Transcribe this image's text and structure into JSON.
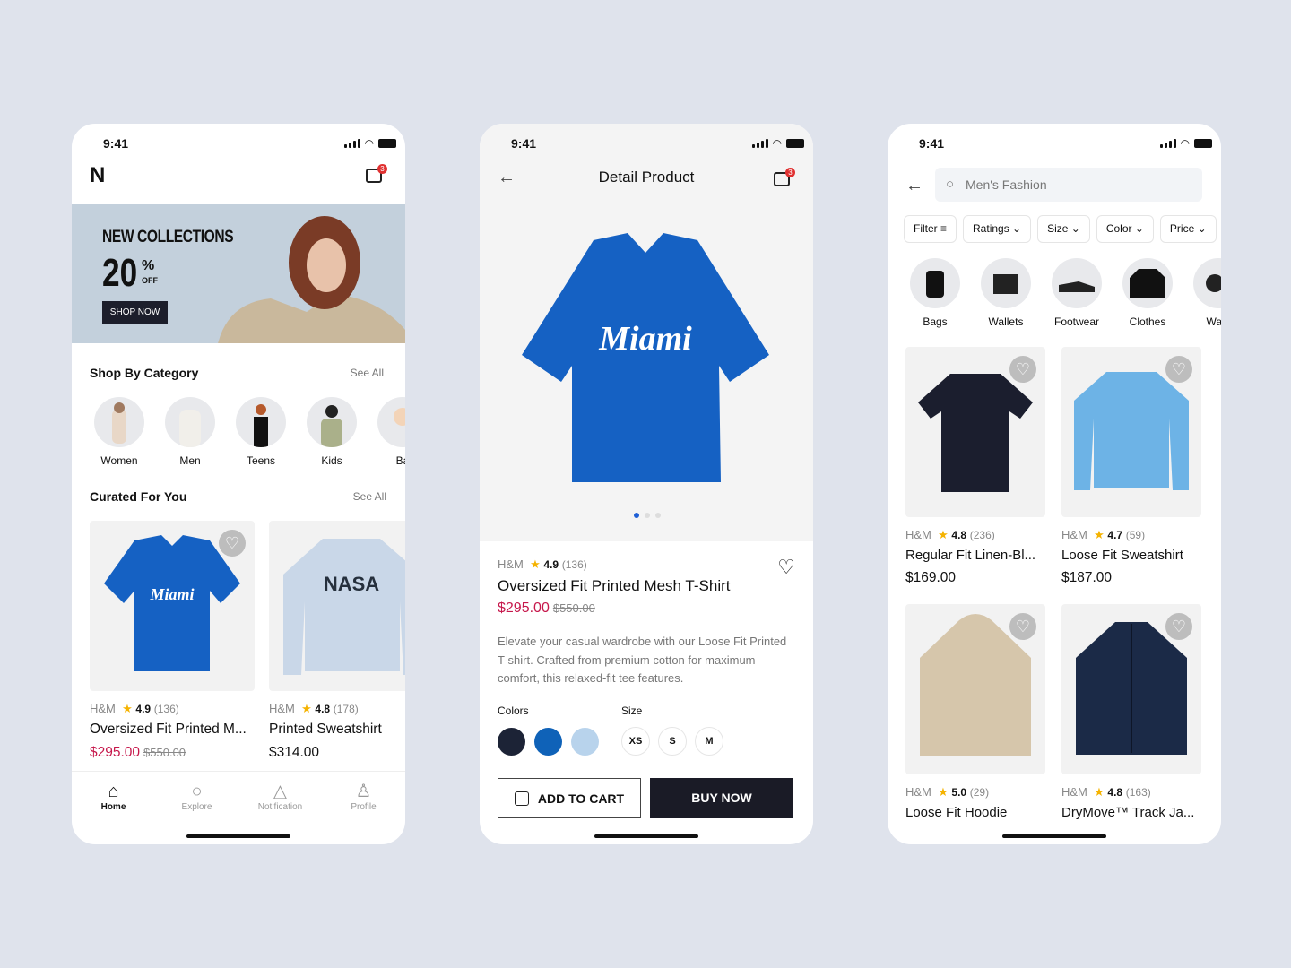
{
  "status": {
    "time": "9:41"
  },
  "cart_badge": "3",
  "home": {
    "logo": "N",
    "banner": {
      "title": "NEW COLLECTIONS",
      "percent": "20",
      "percent_symbol": "%",
      "off": "OFF",
      "button": "SHOP NOW"
    },
    "shop_by_category": {
      "title": "Shop By Category",
      "see_all": "See All",
      "items": [
        {
          "label": "Women"
        },
        {
          "label": "Men"
        },
        {
          "label": "Teens"
        },
        {
          "label": "Kids"
        },
        {
          "label": "Ba"
        }
      ]
    },
    "curated": {
      "title": "Curated For You",
      "see_all": "See All",
      "products": [
        {
          "brand": "H&M",
          "rating": "4.9",
          "reviews": "(136)",
          "name": "Oversized Fit Printed M...",
          "price": "$295.00",
          "old_price": "$550.00"
        },
        {
          "brand": "H&M",
          "rating": "4.8",
          "reviews": "(178)",
          "name": "Printed Sweatshirt",
          "price": "$314.00",
          "old_price": ""
        }
      ]
    },
    "nav": [
      {
        "label": "Home",
        "icon": "home-icon"
      },
      {
        "label": "Explore",
        "icon": "search-icon"
      },
      {
        "label": "Notification",
        "icon": "bell-icon"
      },
      {
        "label": "Profile",
        "icon": "user-icon"
      }
    ]
  },
  "detail": {
    "title": "Detail Product",
    "brand": "H&M",
    "rating": "4.9",
    "reviews": "(136)",
    "name": "Oversized Fit Printed Mesh T-Shirt",
    "price": "$295.00",
    "old_price": "$550.00",
    "description": "Elevate your casual wardrobe with our Loose Fit Printed T-shirt. Crafted from premium cotton for maximum comfort, this relaxed-fit tee features.",
    "colors_label": "Colors",
    "colors": [
      "#1c2336",
      "#0f62b8",
      "#b8d3ec"
    ],
    "size_label": "Size",
    "sizes": [
      "XS",
      "S",
      "M"
    ],
    "add_to_cart": "ADD TO CART",
    "buy_now": "BUY NOW",
    "carousel": {
      "current": 1,
      "total": 3
    }
  },
  "search": {
    "query": "Men's Fashion",
    "chips": [
      {
        "label": "Filter ≡"
      },
      {
        "label": "Ratings ⌄"
      },
      {
        "label": "Size ⌄"
      },
      {
        "label": "Color ⌄"
      },
      {
        "label": "Price ⌄"
      }
    ],
    "categories": [
      {
        "label": "Bags"
      },
      {
        "label": "Wallets"
      },
      {
        "label": "Footwear"
      },
      {
        "label": "Clothes"
      },
      {
        "label": "Watc"
      }
    ],
    "products": [
      {
        "brand": "H&M",
        "rating": "4.8",
        "reviews": "(236)",
        "name": "Regular Fit Linen-Bl...",
        "price": "$169.00"
      },
      {
        "brand": "H&M",
        "rating": "4.7",
        "reviews": "(59)",
        "name": "Loose Fit Sweatshirt",
        "price": "$187.00"
      },
      {
        "brand": "H&M",
        "rating": "5.0",
        "reviews": "(29)",
        "name": "Loose Fit Hoodie",
        "price": ""
      },
      {
        "brand": "H&M",
        "rating": "4.8",
        "reviews": "(163)",
        "name": "DryMove™ Track Ja...",
        "price": ""
      }
    ]
  },
  "icons": {
    "heart": "♡",
    "star": "★",
    "back": "←",
    "search": "○"
  }
}
